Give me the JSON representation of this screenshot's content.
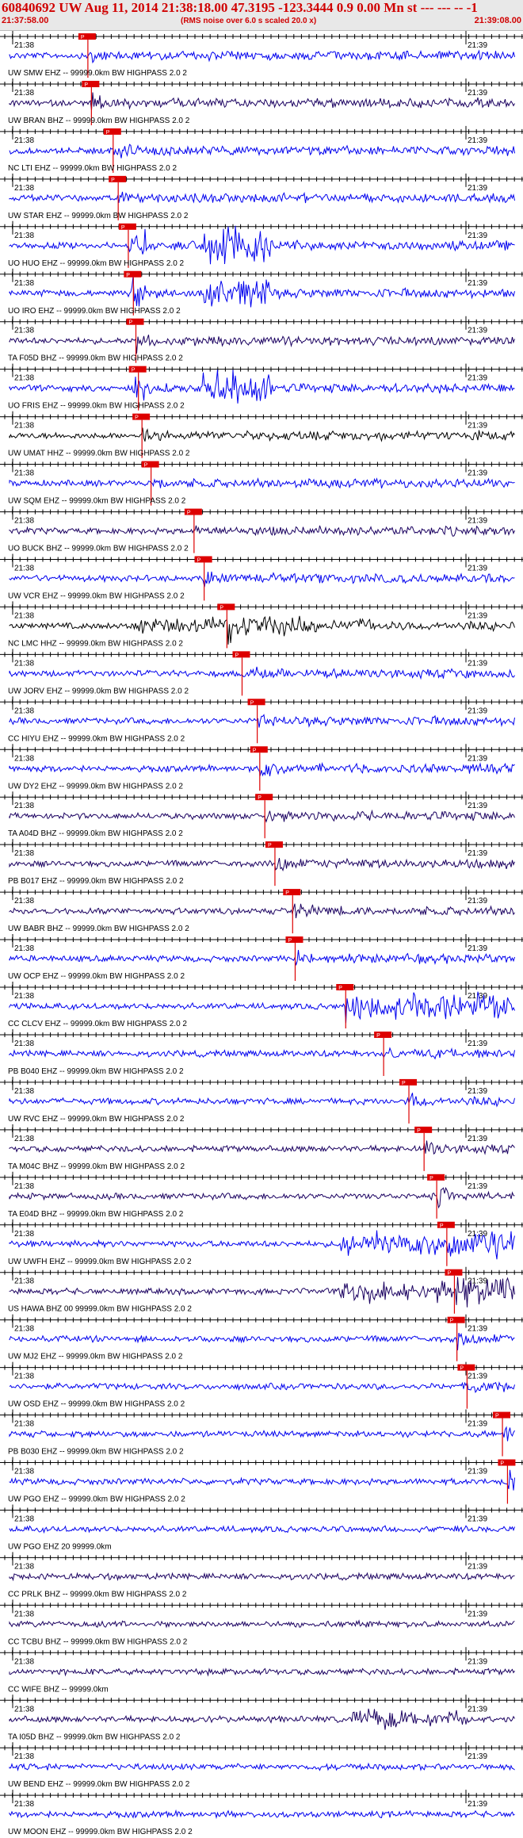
{
  "header": {
    "title": "60840692 UW Aug 11, 2014 21:38:18.00   47.3195 -123.3444  0.9 0.00 Mn st --- --- --  -1",
    "start_time": "21:37:58.00",
    "end_time": "21:39:08.00",
    "rms_note": "(RMS noise over 6.0 s scaled 20.0 x)"
  },
  "colors": {
    "title_red": "#d00000",
    "pick_red": "#dd0000",
    "trace_blue": "#0000ee",
    "trace_purple": "#1a0060",
    "trace_black": "#000000"
  },
  "time_labels": {
    "left": "21:38",
    "right": "21:39"
  },
  "traces": [
    {
      "label": "UW SMW EHZ -- 99999.0km BW  HIGHPASS  2.0  2",
      "pick": "P",
      "pick_frac": 0.155,
      "color": "blue"
    },
    {
      "label": "UW BRAN BHZ -- 99999.0km BW  HIGHPASS  2.0  2",
      "pick": "P",
      "pick_frac": 0.162,
      "color": "purple"
    },
    {
      "label": "NC LTI EHZ -- 99999.0km BW  HIGHPASS  2.0  2",
      "pick": "P",
      "pick_frac": 0.205,
      "color": "blue"
    },
    {
      "label": "UW STAR EHZ -- 99999.0km BW  HIGHPASS  2.0  2",
      "pick": "P",
      "pick_frac": 0.215,
      "color": "blue"
    },
    {
      "label": "UO HUO EHZ -- 99999.0km BW  HIGHPASS  2.0  2",
      "pick": "P",
      "pick_frac": 0.235,
      "color": "blue"
    },
    {
      "label": "UO IRO EHZ -- 99999.0km BW  HIGHPASS  2.0  2",
      "pick": "P",
      "pick_frac": 0.245,
      "color": "blue"
    },
    {
      "label": "TA F05D BHZ -- 99999.0km BW  HIGHPASS  2.0  2",
      "pick": "P",
      "pick_frac": 0.25,
      "color": "purple"
    },
    {
      "label": "UO FRIS EHZ -- 99999.0km BW  HIGHPASS  2.0  2",
      "pick": "P",
      "pick_frac": 0.255,
      "color": "blue"
    },
    {
      "label": "UW UMAT HHZ -- 99999.0km BW  HIGHPASS  2.0  2",
      "pick": "P",
      "pick_frac": 0.262,
      "color": "black"
    },
    {
      "label": "UW SQM EHZ -- 99999.0km BW  HIGHPASS  2.0  2",
      "pick": "P",
      "pick_frac": 0.28,
      "color": "blue"
    },
    {
      "label": "UO BUCK BHZ -- 99999.0km BW  HIGHPASS  2.0  2",
      "pick": "P",
      "pick_frac": 0.365,
      "color": "purple"
    },
    {
      "label": "UW VCR EHZ -- 99999.0km BW  HIGHPASS  2.0  2",
      "pick": "P",
      "pick_frac": 0.385,
      "color": "blue"
    },
    {
      "label": "NC LMC HHZ -- 99999.0km BW  HIGHPASS  2.0  2",
      "pick": "P",
      "pick_frac": 0.43,
      "color": "black"
    },
    {
      "label": "UW JORV EHZ -- 99999.0km BW  HIGHPASS  2.0  2",
      "pick": "P",
      "pick_frac": 0.46,
      "color": "blue"
    },
    {
      "label": "CC HIYU EHZ -- 99999.0km BW  HIGHPASS  2.0  2",
      "pick": "P",
      "pick_frac": 0.49,
      "color": "blue"
    },
    {
      "label": "UW DY2 EHZ -- 99999.0km BW  HIGHPASS  2.0  2",
      "pick": "P",
      "pick_frac": 0.495,
      "color": "blue"
    },
    {
      "label": "TA A04D BHZ -- 99999.0km BW  HIGHPASS  2.0  2",
      "pick": "P",
      "pick_frac": 0.505,
      "color": "purple"
    },
    {
      "label": "PB B017 EHZ -- 99999.0km BW  HIGHPASS  2.0  2",
      "pick": "P",
      "pick_frac": 0.525,
      "color": "purple"
    },
    {
      "label": "UW BABR BHZ -- 99999.0km BW  HIGHPASS  2.0  2",
      "pick": "P",
      "pick_frac": 0.56,
      "color": "purple"
    },
    {
      "label": "UW OCP EHZ -- 99999.0km BW  HIGHPASS  2.0  2",
      "pick": "P",
      "pick_frac": 0.565,
      "color": "blue"
    },
    {
      "label": "CC CLCV EHZ -- 99999.0km BW  HIGHPASS  2.0  2",
      "pick": "P",
      "pick_frac": 0.665,
      "color": "blue"
    },
    {
      "label": "PB B040 EHZ -- 99999.0km BW  HIGHPASS  2.0  2",
      "pick": "P",
      "pick_frac": 0.74,
      "color": "blue"
    },
    {
      "label": "UW RVC EHZ -- 99999.0km BW  HIGHPASS  2.0  2",
      "pick": "P",
      "pick_frac": 0.79,
      "color": "blue"
    },
    {
      "label": "TA M04C BHZ -- 99999.0km BW  HIGHPASS  2.0  2",
      "pick": "P",
      "pick_frac": 0.82,
      "color": "purple"
    },
    {
      "label": "TA E04D BHZ -- 99999.0km BW  HIGHPASS  2.0  2",
      "pick": "P",
      "pick_frac": 0.845,
      "color": "purple"
    },
    {
      "label": "UW UWFH EHZ -- 99999.0km BW  HIGHPASS  2.0  2",
      "pick": "P",
      "pick_frac": 0.865,
      "color": "blue"
    },
    {
      "label": "US HAWA BHZ 00 99999.0km BW  HIGHPASS  2.0  2",
      "pick": "P",
      "pick_frac": 0.88,
      "color": "purple"
    },
    {
      "label": "UW MJ2 EHZ -- 99999.0km BW  HIGHPASS  2.0  2",
      "pick": "P",
      "pick_frac": 0.885,
      "color": "blue"
    },
    {
      "label": "UW OSD EHZ -- 99999.0km BW  HIGHPASS  2.0  2",
      "pick": "P",
      "pick_frac": 0.905,
      "color": "blue"
    },
    {
      "label": "PB B030 EHZ -- 99999.0km BW  HIGHPASS  2.0  2",
      "pick": "P",
      "pick_frac": 0.975,
      "color": "blue"
    },
    {
      "label": "UW PGO EHZ -- 99999.0km BW  HIGHPASS  2.0  2",
      "pick": "P",
      "pick_frac": 0.985,
      "color": "blue"
    },
    {
      "label": "UW PGO EHZ 20 99999.0km",
      "pick": "",
      "color": "blue"
    },
    {
      "label": "CC PRLK BHZ -- 99999.0km BW  HIGHPASS  2.0  2",
      "pick": "",
      "color": "purple"
    },
    {
      "label": "CC TCBU BHZ -- 99999.0km BW  HIGHPASS  2.0  2",
      "pick": "",
      "color": "purple"
    },
    {
      "label": "CC WIFE BHZ -- 99999.0km",
      "pick": "",
      "color": "purple"
    },
    {
      "label": "TA I05D BHZ -- 99999.0km BW  HIGHPASS  2.0  2",
      "pick": "",
      "color": "purple"
    },
    {
      "label": "UW BEND EHZ -- 99999.0km BW  HIGHPASS  2.0  2",
      "pick": "",
      "color": "blue"
    },
    {
      "label": "UW MOON EHZ -- 99999.0km BW  HIGHPASS  2.0  2",
      "pick": "",
      "color": "blue"
    }
  ]
}
